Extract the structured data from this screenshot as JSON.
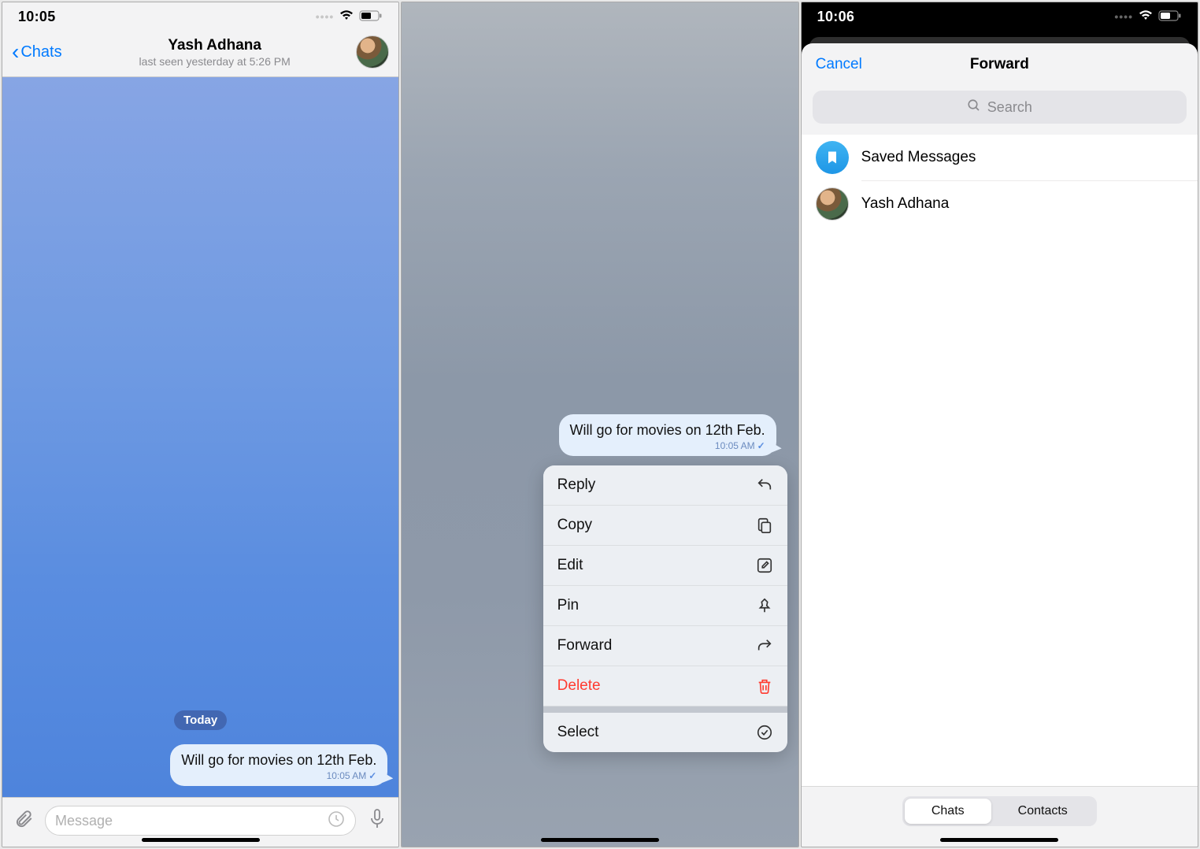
{
  "panel1": {
    "status": {
      "time": "10:05"
    },
    "header": {
      "back_label": "Chats",
      "name": "Yash Adhana",
      "last_seen": "last seen yesterday at 5:26 PM"
    },
    "chat": {
      "date_chip": "Today",
      "message_text": "Will go for movies on 12th Feb.",
      "message_time": "10:05 AM"
    },
    "input": {
      "placeholder": "Message"
    }
  },
  "panel2": {
    "bubble": {
      "text": "Will go for movies on 12th Feb.",
      "time": "10:05 AM"
    },
    "menu": {
      "reply": "Reply",
      "copy": "Copy",
      "edit": "Edit",
      "pin": "Pin",
      "forward": "Forward",
      "delete": "Delete",
      "select": "Select"
    }
  },
  "panel3": {
    "status": {
      "time": "10:06"
    },
    "header": {
      "cancel": "Cancel",
      "title": "Forward"
    },
    "search_placeholder": "Search",
    "rows": {
      "saved": "Saved Messages",
      "contact1": "Yash Adhana"
    },
    "segmented": {
      "chats": "Chats",
      "contacts": "Contacts"
    }
  },
  "icons": {
    "back_chevron": "back-chevron-icon",
    "wifi": "wifi-icon",
    "battery": "battery-icon",
    "attach": "paperclip-icon",
    "clock": "clock-icon",
    "mic": "microphone-icon",
    "reply": "reply-icon",
    "copy": "copy-icon",
    "edit": "edit-icon",
    "pin": "pin-icon",
    "forward": "forward-icon",
    "trash": "trash-icon",
    "select": "checkmark-circle-icon",
    "search": "search-icon",
    "bookmark": "bookmark-icon"
  }
}
